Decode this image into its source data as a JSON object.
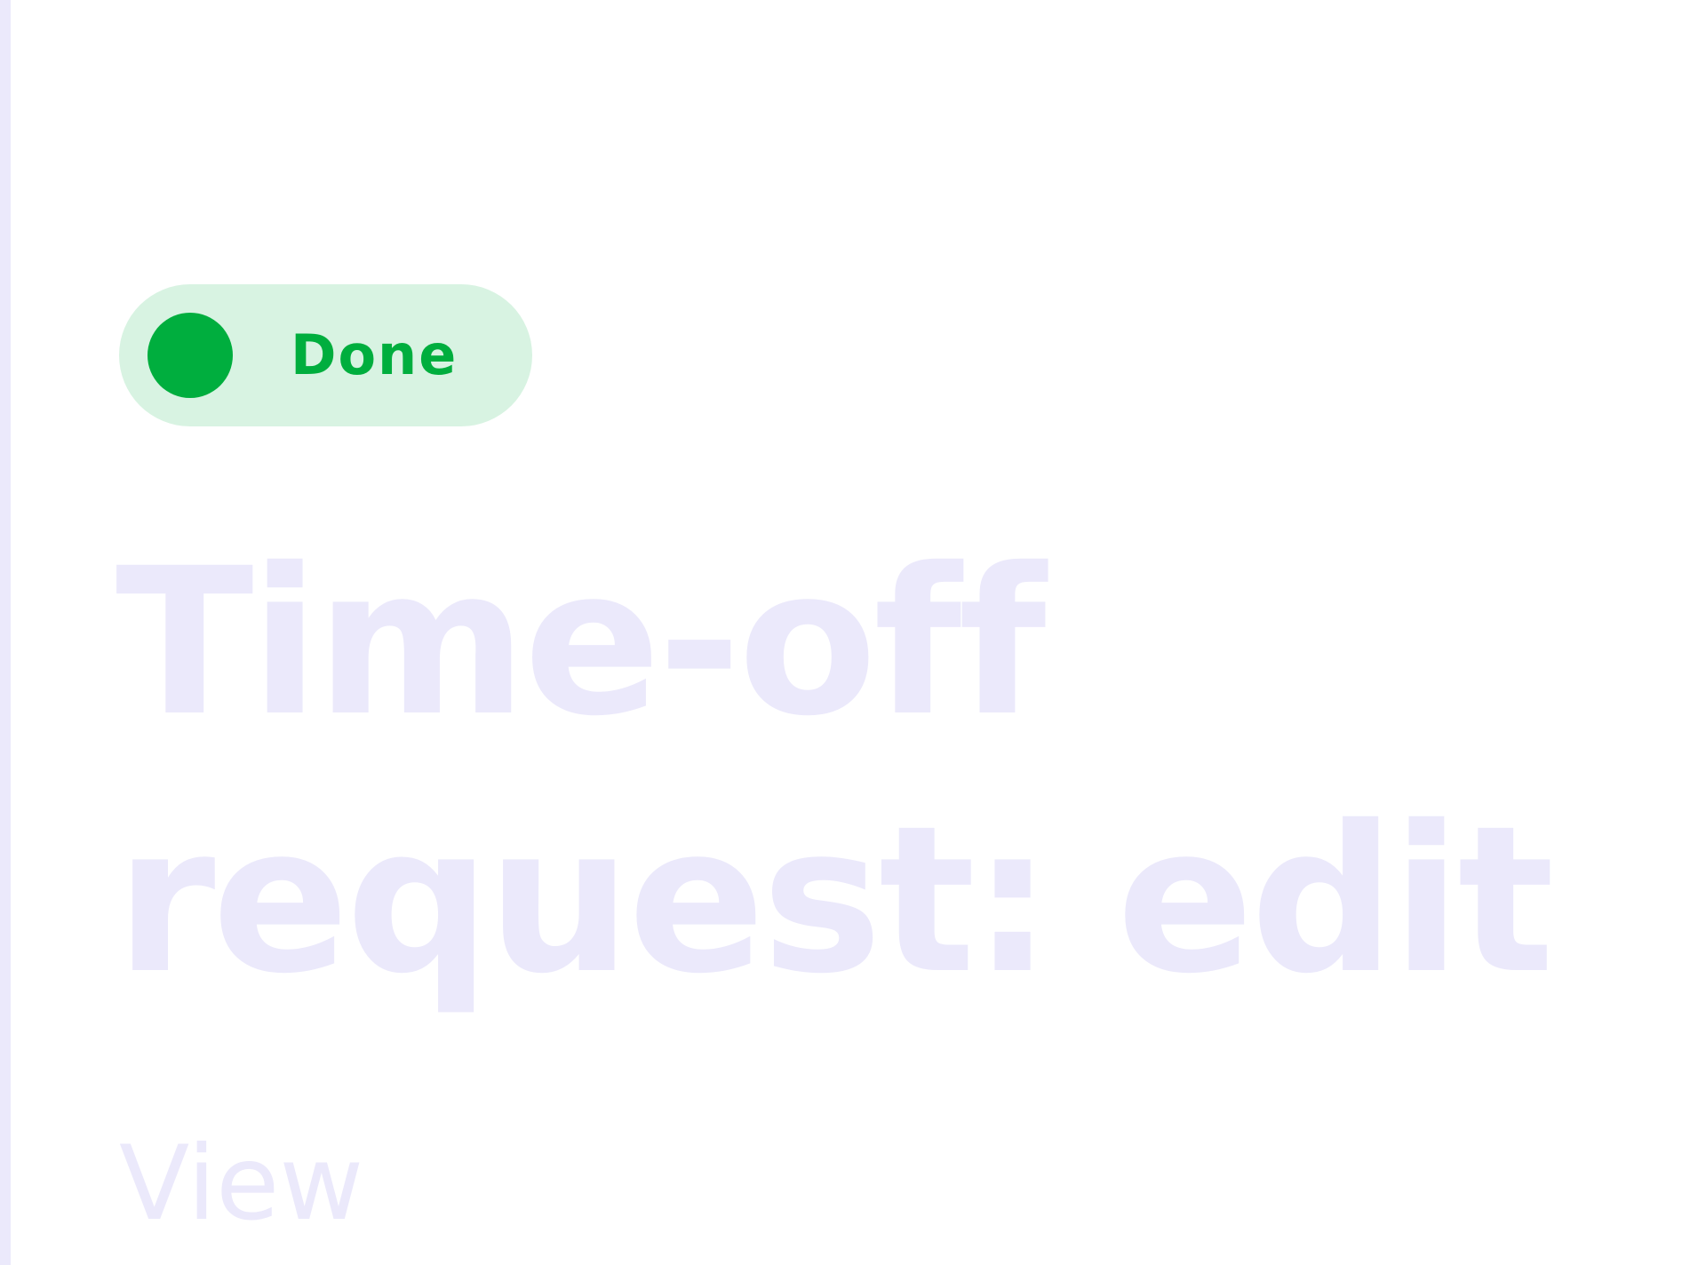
{
  "status_badge": {
    "label": "Done",
    "dot_color": "#00ae3e",
    "background_color": "#d8f3e2"
  },
  "page_title": {
    "line1": "Time-off",
    "line2": "request: edit",
    "color": "#ebe9fb"
  },
  "view_link": {
    "label": "View",
    "color": "#ebe9fb"
  },
  "left_rule_color": "#ebe9fb"
}
